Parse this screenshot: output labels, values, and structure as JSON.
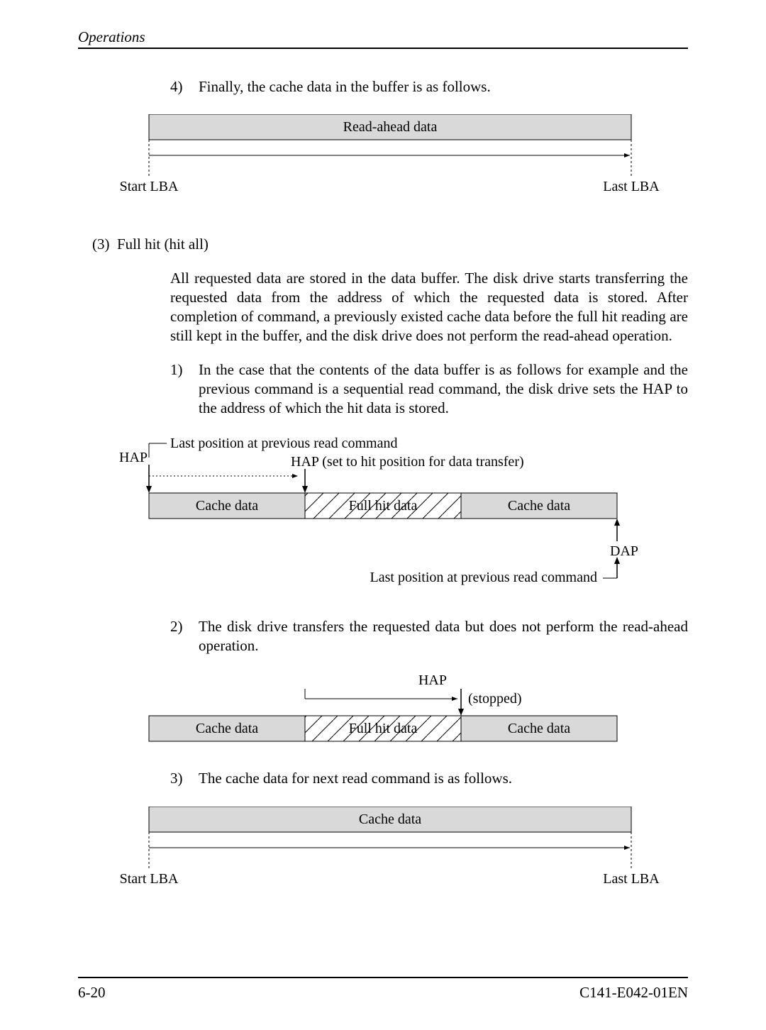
{
  "header": {
    "title": "Operations"
  },
  "item4": {
    "num": "4)",
    "text": "Finally, the cache data in the buffer is as follows."
  },
  "diag1": {
    "box": "Read-ahead data",
    "left": "Start LBA",
    "right": "Last LBA"
  },
  "sec3": {
    "num": "(3)",
    "title": "Full hit (hit all)",
    "para": "All requested data are stored in the data buffer.  The disk drive starts transferring the requested data from the address of which the requested data is stored.  After completion of command, a previously existed cache data before the full hit reading are still kept in the buffer, and the disk drive does not perform the read-ahead operation."
  },
  "item1": {
    "num": "1)",
    "text": "In the case that the contents of the data buffer is as follows for example and the previous command is a sequential read command, the disk drive sets the HAP to the address of which the hit data is stored."
  },
  "diag2": {
    "lastpos_top": "Last position at previous read command",
    "hap": "HAP",
    "hap_note": "HAP (set to hit position for data transfer)",
    "cache_left": "Cache data",
    "full_hit": "Full hit data",
    "cache_right": "Cache data",
    "dap": "DAP",
    "lastpos_bot": "Last position at previous read command"
  },
  "item2": {
    "num": "2)",
    "text": "The disk drive transfers the requested data but does not perform the read-ahead operation."
  },
  "diag3": {
    "hap": "HAP",
    "stopped": "(stopped)",
    "cache_left": "Cache data",
    "full_hit": "Full hit data",
    "cache_right": "Cache data"
  },
  "item3": {
    "num": "3)",
    "text": "The cache data for next read command is as follows."
  },
  "diag4": {
    "box": "Cache data",
    "left": "Start LBA",
    "right": "Last LBA"
  },
  "footer": {
    "left": "6-20",
    "right": "C141-E042-01EN"
  }
}
